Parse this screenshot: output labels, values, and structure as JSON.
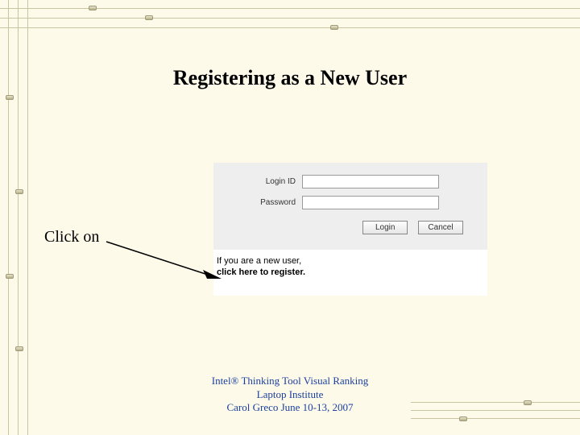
{
  "title": "Registering as a New User",
  "instruction": "Click on",
  "form": {
    "login_label": "Login ID",
    "password_label": "Password",
    "login_value": "",
    "password_value": "",
    "login_button": "Login",
    "cancel_button": "Cancel"
  },
  "new_user": {
    "line1": "If you are a new user,",
    "line2": "click here to register."
  },
  "footer": {
    "l1": "Intel® Thinking Tool Visual Ranking",
    "l2": "Laptop Institute",
    "l3": "Carol Greco June 10‑13, 2007"
  }
}
